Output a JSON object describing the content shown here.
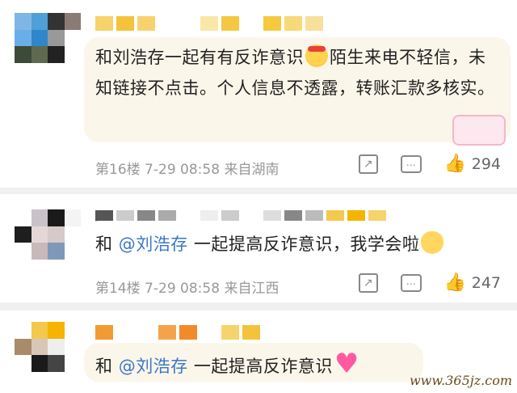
{
  "comments": [
    {
      "text_a": "和刘浩存一起有有反诈意识",
      "emoji_a": "smile-emoji",
      "text_b": "陌生来电不轻信，未知链接不点击。个人信息不透露，转账汇款多核实。",
      "floor": "第16楼",
      "date": "7-29",
      "time": "08:58",
      "location": "来自湖南",
      "likes": "294"
    },
    {
      "prefix": "和 ",
      "mention": "@刘浩存",
      "text": " 一起提高反诈意识，我学会啦",
      "emoji": "waving-hand-emoji",
      "floor": "第14楼",
      "date": "7-29",
      "time": "08:58",
      "location": "来自江西",
      "likes": "247"
    },
    {
      "prefix": "和 ",
      "mention": "@刘浩存",
      "text": " 一起提高反诈意识",
      "emoji": "heart-emoji"
    }
  ],
  "colors": {
    "bubble": "#fbf6ea",
    "mention": "#3b77c7",
    "meta": "#999999"
  },
  "icons": [
    "share-icon",
    "comment-icon",
    "like-icon"
  ],
  "watermark": "www.365jz.com"
}
